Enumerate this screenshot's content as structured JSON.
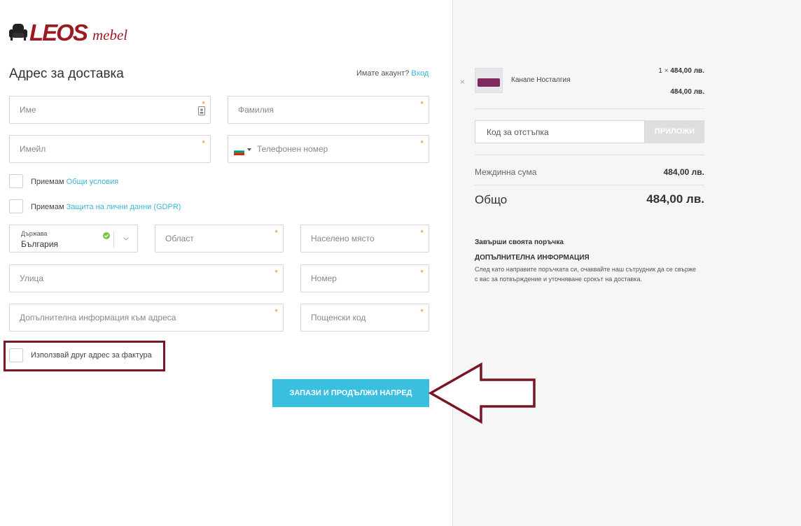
{
  "brand": {
    "logo_main": "LEOS",
    "logo_sub": "mebel"
  },
  "form": {
    "title": "Адрес за доставка",
    "account_prompt": "Имате акаунт?",
    "login_link": "Вход",
    "first_name_placeholder": "Име",
    "last_name_placeholder": "Фамилия",
    "email_placeholder": "Имейл",
    "phone_placeholder": "Телефонен номер",
    "required_mark": "*",
    "terms_prefix": "Приемам",
    "terms_link": "Общи условия",
    "gdpr_prefix": "Приемам",
    "gdpr_link": "Защита на лични данни (GDPR)",
    "country_label": "Държава",
    "country_value": "България",
    "region_placeholder": "Област",
    "city_placeholder": "Населено място",
    "street_placeholder": "Улица",
    "number_placeholder": "Номер",
    "address_info_placeholder": "Допълнителна информация към адреса",
    "postal_placeholder": "Пощенски код",
    "invoice_address_label": "Използвай друг адрес за фактура",
    "save_button": "ЗАПАЗИ И ПРОДЪЛЖИ НАПРЕД"
  },
  "cart": {
    "product_name": "Канапе Носталгия",
    "quantity": "1",
    "times": "×",
    "unit_price": "484,00 лв.",
    "line_total": "484,00 лв.",
    "remove_glyph": "×",
    "coupon_placeholder": "Код за отстъпка",
    "apply_button": "ПРИЛОЖИ",
    "subtotal_label": "Междинна сума",
    "subtotal_value": "484,00 лв.",
    "total_label": "Общо",
    "total_value": "484,00 лв.",
    "finish_order": "Завърши своята поръчка",
    "extra_info_title": "ДОПЪЛНИТЕЛНА ИНФОРМАЦИЯ",
    "extra_info_text": "След като направите поръчката си, очаквайте наш сътрудник да се свърже с вас за потвърждение и уточняване срокът на доставка."
  },
  "colors": {
    "accent": "#3bbfdf",
    "brand": "#9c1b22",
    "highlight": "#7a1525"
  }
}
